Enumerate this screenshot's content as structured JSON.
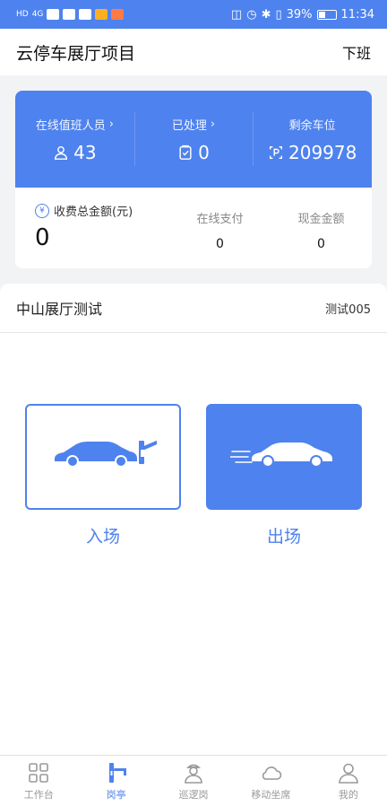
{
  "status_bar": {
    "left": [
      "HD",
      "4G"
    ],
    "battery": "39%",
    "time": "11:34"
  },
  "header": {
    "title": "云停车展厅项目",
    "right_action": "下班"
  },
  "stats": {
    "on_duty": {
      "label": "在线值班人员",
      "value": "43",
      "icon": "user-icon"
    },
    "processed": {
      "label": "已处理",
      "value": "0",
      "icon": "checklist-icon"
    },
    "remaining": {
      "label": "剩余车位",
      "value": "209978",
      "icon": "parking-icon"
    }
  },
  "fees": {
    "total": {
      "label": "收费总金额(元)",
      "value": "0"
    },
    "online": {
      "label": "在线支付",
      "value": "0"
    },
    "cash": {
      "label": "现金金额",
      "value": "0"
    }
  },
  "hall": {
    "name": "中山展厅测试",
    "code": "测试005"
  },
  "actions": {
    "entry_label": "入场",
    "exit_label": "出场"
  },
  "tabs": [
    {
      "label": "工作台",
      "icon": "grid-icon"
    },
    {
      "label": "岗亭",
      "icon": "booth-icon"
    },
    {
      "label": "巡逻岗",
      "icon": "patrol-icon"
    },
    {
      "label": "移动坐席",
      "icon": "cloud-icon"
    },
    {
      "label": "我的",
      "icon": "profile-icon"
    }
  ],
  "colors": {
    "accent": "#4e82ee",
    "inactive": "#999999"
  }
}
